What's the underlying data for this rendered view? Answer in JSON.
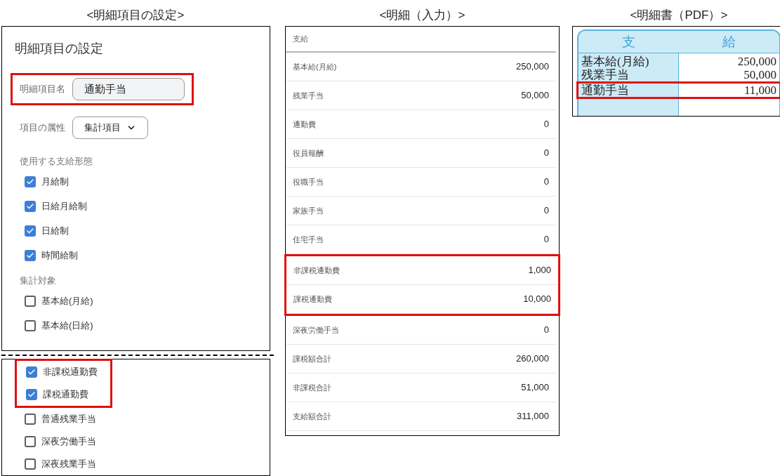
{
  "settings": {
    "caption": "<明細項目の設定>",
    "title": "明細項目の設定",
    "name_field": {
      "label": "明細項目名",
      "value": "通勤手当",
      "highlighted": true
    },
    "attribute": {
      "label": "項目の属性",
      "value": "集計項目"
    },
    "pay_types": {
      "heading": "使用する支給形態",
      "options": [
        {
          "label": "月給制",
          "checked": true,
          "highlighted": false
        },
        {
          "label": "日給月給制",
          "checked": true,
          "highlighted": false
        },
        {
          "label": "日給制",
          "checked": true,
          "highlighted": false
        },
        {
          "label": "時間給制",
          "checked": true,
          "highlighted": false
        }
      ]
    },
    "aggregation": {
      "heading": "集計対象",
      "options": [
        {
          "label": "基本給(月給)",
          "checked": false,
          "highlighted": false
        },
        {
          "label": "基本給(日給)",
          "checked": false,
          "highlighted": false
        }
      ],
      "continued_options": [
        {
          "label": "非課税通勤費",
          "checked": true,
          "highlighted": true
        },
        {
          "label": "課税通勤費",
          "checked": true,
          "highlighted": true
        },
        {
          "label": "普通残業手当",
          "checked": false,
          "highlighted": false
        },
        {
          "label": "深夜労働手当",
          "checked": false,
          "highlighted": false
        },
        {
          "label": "深夜残業手当",
          "checked": false,
          "highlighted": false
        }
      ]
    }
  },
  "input_detail": {
    "caption": "<明細（入力）>",
    "header": "支給",
    "rows": [
      {
        "label": "基本給(月給)",
        "value": "250,000",
        "highlighted": false
      },
      {
        "label": "残業手当",
        "value": "50,000",
        "highlighted": false
      },
      {
        "label": "通勤費",
        "value": "0",
        "highlighted": false
      },
      {
        "label": "役員報酬",
        "value": "0",
        "highlighted": false
      },
      {
        "label": "役職手当",
        "value": "0",
        "highlighted": false
      },
      {
        "label": "家族手当",
        "value": "0",
        "highlighted": false
      },
      {
        "label": "住宅手当",
        "value": "0",
        "highlighted": false
      },
      {
        "label": "非課税通勤費",
        "value": "1,000",
        "highlighted": true
      },
      {
        "label": "課税通勤費",
        "value": "10,000",
        "highlighted": true
      },
      {
        "label": "深夜労働手当",
        "value": "0",
        "highlighted": false
      },
      {
        "label": "課税額合計",
        "value": "260,000",
        "highlighted": false
      },
      {
        "label": "非課税合計",
        "value": "51,000",
        "highlighted": false
      },
      {
        "label": "支給額合計",
        "value": "311,000",
        "highlighted": false
      }
    ]
  },
  "pdf": {
    "caption": "<明細書（PDF）>",
    "header": [
      "支",
      "給"
    ],
    "rows": [
      {
        "label": "基本給(月給)",
        "value": "250,000",
        "highlighted": false
      },
      {
        "label": "残業手当",
        "value": "50,000",
        "highlighted": false
      },
      {
        "label": "通勤手当",
        "value": "11,000",
        "highlighted": true
      }
    ]
  }
}
